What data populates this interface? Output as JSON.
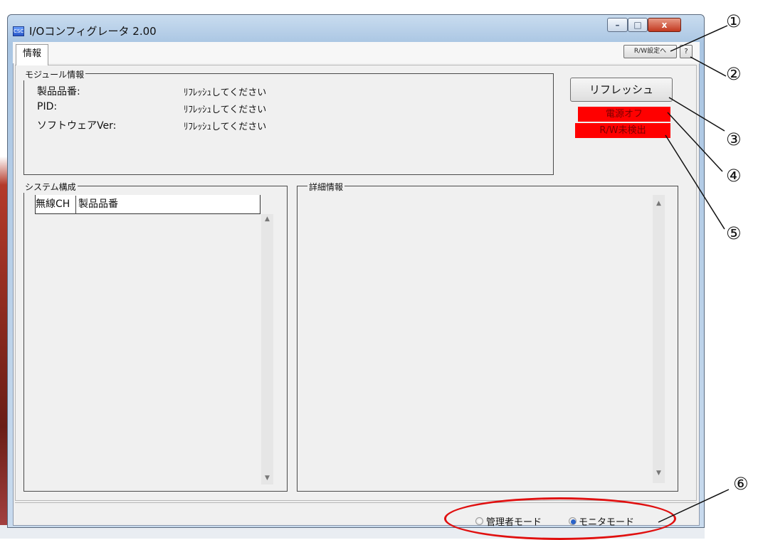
{
  "window": {
    "title": "I/Oコンフィグレータ 2.00",
    "icon": "app-icon",
    "icon_text": "CSC",
    "minimize_label": "–",
    "maximize_label": "□",
    "close_label": "x"
  },
  "tabs": [
    {
      "label": "情報",
      "selected": true
    }
  ],
  "toolbar": {
    "rw_settings_label": "R/W設定へ",
    "help_label": "?"
  },
  "module_info": {
    "group_label": "モジュール情報",
    "rows": [
      {
        "label": "製品品番:",
        "value": "ﾘﾌﾚｯｼｭしてください"
      },
      {
        "label": "PID:",
        "value": "ﾘﾌﾚｯｼｭしてください"
      },
      {
        "label": "ソフトウェアVer:",
        "value": "ﾘﾌﾚｯｼｭしてください"
      }
    ]
  },
  "actions": {
    "refresh_label": "リフレッシュ"
  },
  "status": {
    "power": "電源オフ",
    "rw": "R/W未検出",
    "alert_color": "#ff0000"
  },
  "system_config": {
    "group_label": "システム構成",
    "columns": [
      "無線CH",
      "製品品番"
    ],
    "rows": []
  },
  "detail_info": {
    "group_label": "詳細情報"
  },
  "mode": {
    "options": [
      {
        "label": "管理者モード",
        "selected": false
      },
      {
        "label": "モニタモード",
        "selected": true
      }
    ]
  },
  "callouts": [
    "①",
    "②",
    "③",
    "④",
    "⑤",
    "⑥"
  ]
}
